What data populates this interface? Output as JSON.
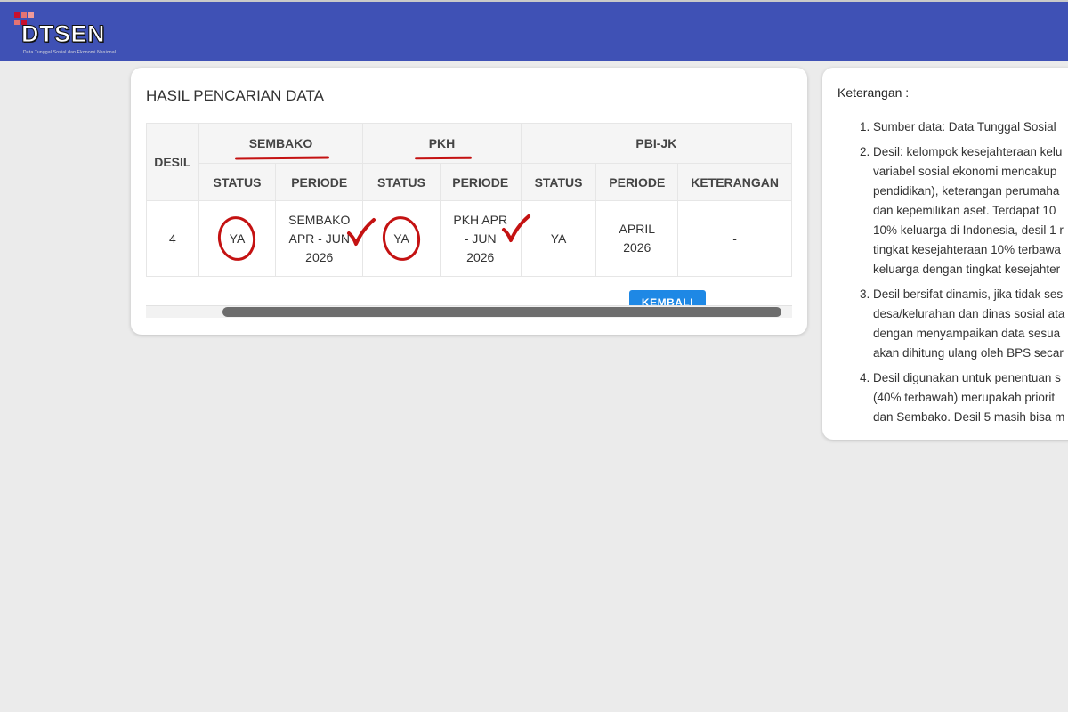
{
  "header": {
    "logo_text": "DTSEN",
    "logo_subtitle": "Data Tunggal Sosial dan Ekonomi Nasional",
    "bg_color": "#3f51b5"
  },
  "main": {
    "title": "HASIL PENCARIAN DATA",
    "table": {
      "col_desil": "DESIL",
      "groups": [
        "SEMBAKO",
        "PKH",
        "PBI-JK"
      ],
      "sub_headers": [
        "STATUS",
        "PERIODE",
        "STATUS",
        "PERIODE",
        "STATUS",
        "PERIODE",
        "KETERANGAN"
      ],
      "row": {
        "desil": "4",
        "sembako_status": "YA",
        "sembako_periode": "SEMBAKO APR - JUN 2026",
        "pkh_status": "YA",
        "pkh_periode": "PKH APR - JUN 2026",
        "pbi_status": "YA",
        "pbi_periode": "APRIL 2026",
        "keterangan": "-"
      }
    },
    "back_button": "KEMBALI"
  },
  "side": {
    "title": "Keterangan :",
    "items": [
      "Sumber data: Data Tunggal Sosial",
      "Desil: kelompok kesejahteraan kelu\nvariabel sosial ekonomi mencakup\npendidikan), keterangan perumaha\ndan kepemilikan aset. Terdapat 10\n10% keluarga di Indonesia, desil 1 r\ntingkat kesejahteraan 10% terbawa\nkeluarga dengan tingkat kesejahter",
      "Desil bersifat dinamis, jika tidak ses\ndesa/kelurahan dan dinas sosial ata\ndengan menyampaikan data sesua\nakan dihitung ulang oleh BPS secar",
      "Desil digunakan untuk penentuan s\n(40% terbawah) merupakah priorit\ndan Sembako. Desil 5 masih bisa m"
    ]
  },
  "annotation_color": "#c41212"
}
